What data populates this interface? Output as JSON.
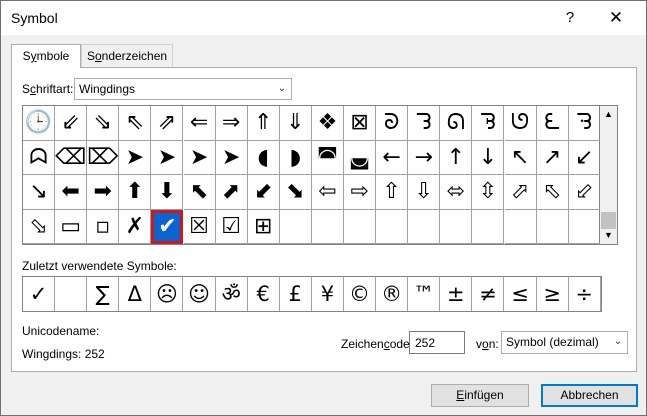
{
  "window": {
    "title": "Symbol",
    "help": "?",
    "close": "✕"
  },
  "tabs": [
    {
      "label": "Symbole",
      "accel": "y",
      "pre": "S",
      "post": "mbole"
    },
    {
      "label": "Sonderzeichen",
      "accel": "o",
      "pre": "S",
      "post": "nderzeichen"
    }
  ],
  "font": {
    "label_pre": "S",
    "label_accel": "c",
    "label_post": "hriftart:",
    "value": "Wingdings"
  },
  "grid": {
    "rows": [
      [
        "🕒",
        "⇙",
        "⇘",
        "⇖",
        "⇗",
        "⇐",
        "⇒",
        "⇑",
        "⇓",
        "❖",
        "⊠",
        "ᘐ",
        "ᘊ",
        "ᘏ",
        "ᘋ",
        "ᘎ",
        "ᘍ",
        "ᘌ"
      ],
      [
        "ᗣ",
        "⌫",
        "⌦",
        "➤",
        "➤",
        "➤",
        "➤",
        "◖",
        "◗",
        "◚",
        "◛",
        "←",
        "→",
        "↑",
        "↓",
        "↖",
        "↗",
        "↙"
      ],
      [
        "↘",
        "⬅",
        "➡",
        "⬆",
        "⬇",
        "⬉",
        "⬈",
        "⬋",
        "⬊",
        "⇦",
        "⇨",
        "⇧",
        "⇩",
        "⬄",
        "⇳",
        "⬀",
        "⬁",
        "⬃"
      ],
      [
        "⬂",
        "▭",
        "▫",
        "✗",
        "✔",
        "☒",
        "☑",
        "⊞",
        "",
        "",
        "",
        "",
        "",
        "",
        "",
        "",
        "",
        ""
      ]
    ],
    "selected": {
      "row": 3,
      "col": 4
    }
  },
  "recent": {
    "label": "Zuletzt verwendete Symbole:",
    "symbols": [
      "✓",
      "",
      "∑",
      "Δ",
      "☹",
      "☺",
      "ॐ",
      "€",
      "£",
      "¥",
      "©",
      "®",
      "™",
      "±",
      "≠",
      "≤",
      "≥",
      "÷"
    ]
  },
  "unicode": {
    "label": "Unicodename:",
    "value": "Wingdings: 252"
  },
  "charcode": {
    "label_pre": "Zeichen",
    "label_accel": "c",
    "label_post": "ode:",
    "value": "252"
  },
  "from": {
    "label_pre": "v",
    "label_accel": "o",
    "label_post": "n:",
    "value": "Symbol (dezimal)"
  },
  "buttons": {
    "insert": {
      "accel": "E",
      "rest": "infügen"
    },
    "cancel": "Abbrechen"
  }
}
